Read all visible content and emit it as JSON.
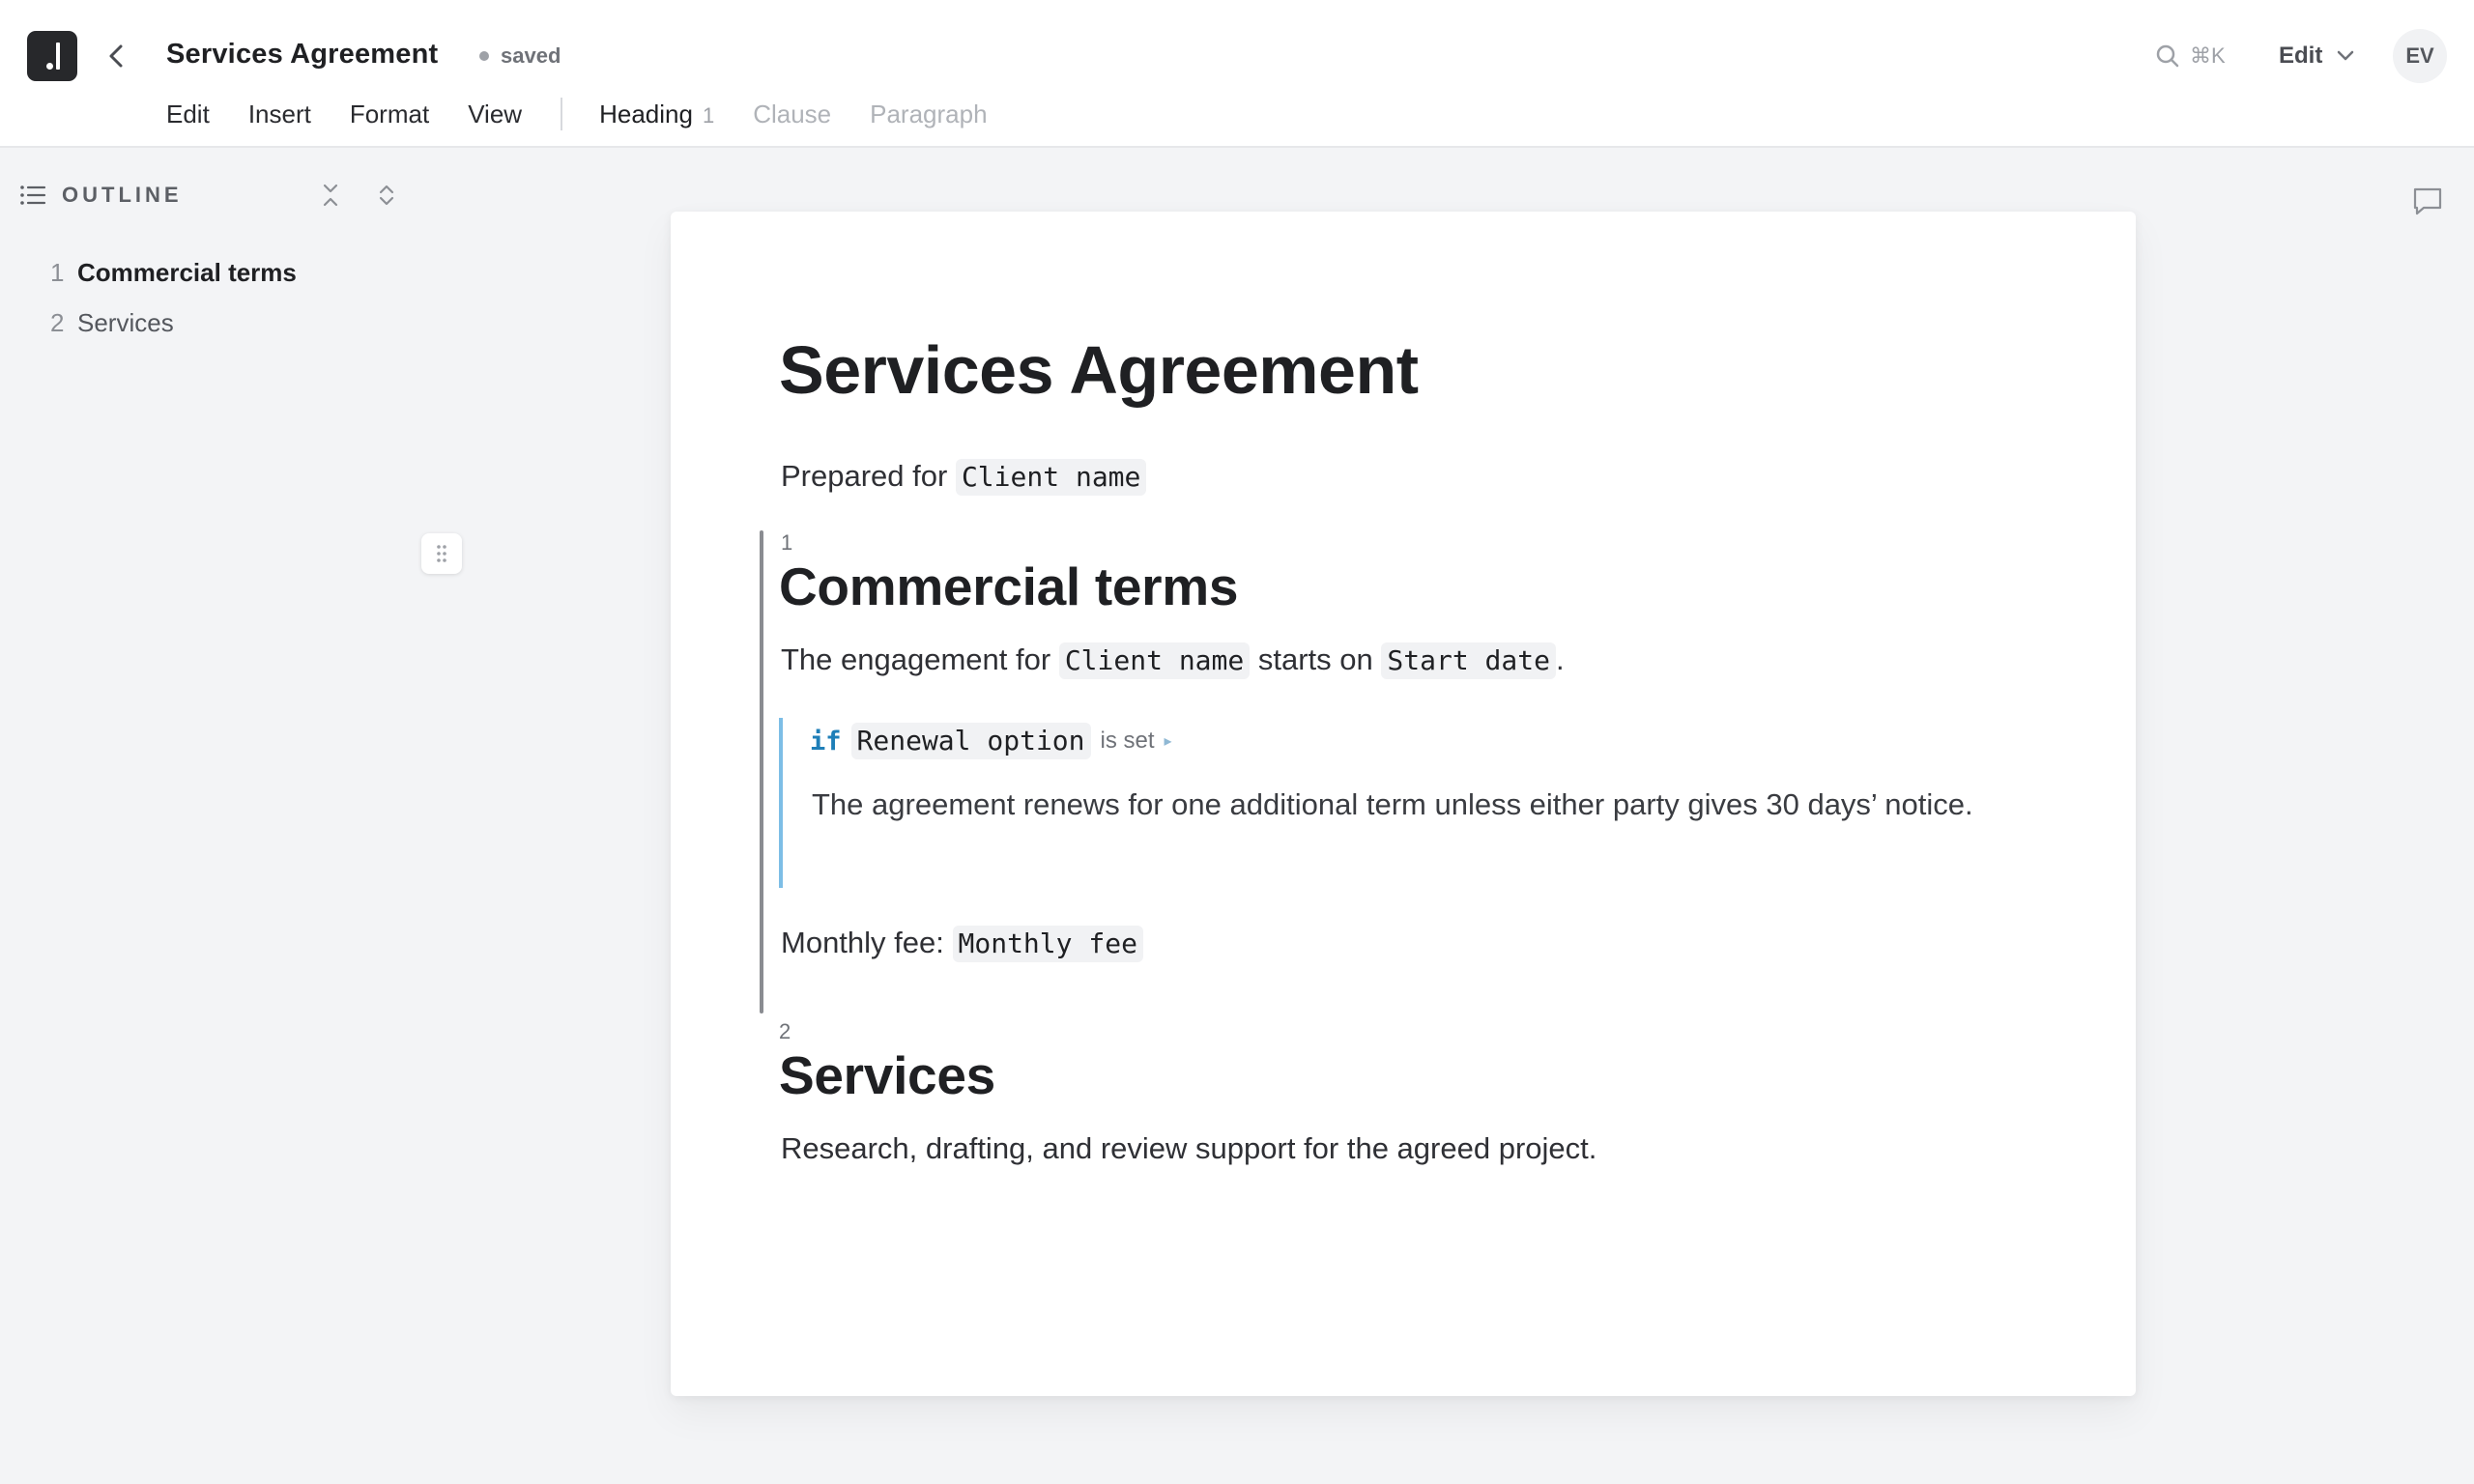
{
  "header": {
    "title": "Services Agreement",
    "save_status": "saved",
    "search_shortcut": "⌘K",
    "mode_label": "Edit",
    "avatar_initials": "EV"
  },
  "menubar": {
    "items": [
      "Edit",
      "Insert",
      "Format",
      "View"
    ],
    "block_types": [
      {
        "label": "Heading",
        "level": "1",
        "active": true
      },
      {
        "label": "Clause",
        "active": false
      },
      {
        "label": "Paragraph",
        "active": false
      }
    ]
  },
  "outline": {
    "title": "OUTLINE",
    "items": [
      {
        "num": "1",
        "label": "Commercial terms",
        "active": true
      },
      {
        "num": "2",
        "label": "Services",
        "active": false
      }
    ]
  },
  "document": {
    "title": "Services Agreement",
    "prepared_prefix": "Prepared for",
    "prepared_var": "Client name",
    "sections": [
      {
        "num": "1",
        "heading": "Commercial terms",
        "engagement": {
          "t1": "The engagement for",
          "v1": "Client name",
          "t2": "starts on",
          "v2": "Start date",
          "t3": "."
        },
        "condition": {
          "keyword": "if",
          "variable": "Renewal option",
          "operator": "is set",
          "body": "The agreement renews for one additional term unless either party gives 30 days’ notice."
        },
        "fee": {
          "label": "Monthly fee:",
          "var": "Monthly fee"
        }
      },
      {
        "num": "2",
        "heading": "Services",
        "body": "Research, drafting, and review support for the agreed project."
      }
    ]
  },
  "colors": {
    "accent_condition": "#7dbee6",
    "keyword": "#1f7fb8",
    "logo_bg": "#27282b"
  }
}
